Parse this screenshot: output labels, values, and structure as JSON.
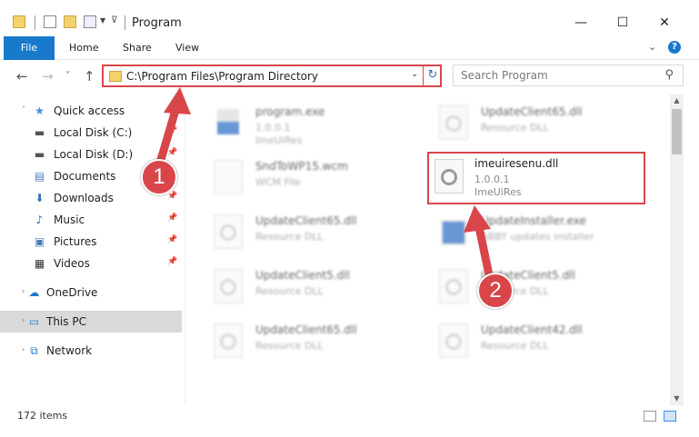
{
  "window": {
    "title": "Program",
    "minimize_glyph": "—",
    "maximize_glyph": "☐",
    "close_glyph": "✕"
  },
  "ribbon": {
    "tabs": [
      "File",
      "Home",
      "Share",
      "View"
    ],
    "help_glyph": "?"
  },
  "nav": {
    "back_glyph": "←",
    "forward_glyph": "→",
    "recent_glyph": "˅",
    "up_glyph": "↑"
  },
  "address": {
    "path": "C:\\Program Files\\Program Directory"
  },
  "search": {
    "placeholder": "Search Program"
  },
  "sidebar": {
    "items": [
      {
        "label": "Quick access",
        "icon": "star-icon"
      },
      {
        "label": "Local Disk (C:)",
        "icon": "drive-icon"
      },
      {
        "label": "Local Disk (D:)",
        "icon": "drive-icon"
      },
      {
        "label": "Documents",
        "icon": "documents-icon"
      },
      {
        "label": "Downloads",
        "icon": "download-icon"
      },
      {
        "label": "Music",
        "icon": "music-icon"
      },
      {
        "label": "Pictures",
        "icon": "pictures-icon"
      },
      {
        "label": "Videos",
        "icon": "videos-icon"
      },
      {
        "label": "OneDrive",
        "icon": "cloud-icon"
      },
      {
        "label": "This PC",
        "icon": "computer-icon"
      },
      {
        "label": "Network",
        "icon": "network-icon"
      }
    ]
  },
  "files": [
    {
      "name": "program.exe",
      "meta1": "1.0.0.1",
      "meta2": "ImeUiRes"
    },
    {
      "name": "UpdateClient65.dll",
      "meta1": "Resource DLL",
      "meta2": ""
    },
    {
      "name": "SndToWP15.wcm",
      "meta1": "WCM File",
      "meta2": ""
    },
    {
      "name": "imeuiresenu.dll",
      "meta1": "1.0.0.1",
      "meta2": "ImeUiRes"
    },
    {
      "name": "UpdateClient65.dll",
      "meta1": "Resource DLL",
      "meta2": ""
    },
    {
      "name": "UpdateInstaller.exe",
      "meta1": "ABBY updates installer",
      "meta2": ""
    },
    {
      "name": "UpdateClient5.dll",
      "meta1": "Resource DLL",
      "meta2": ""
    },
    {
      "name": "UpdateClient5.dll",
      "meta1": "Resource DLL",
      "meta2": ""
    },
    {
      "name": "UpdateClient65.dll",
      "meta1": "Resource DLL",
      "meta2": ""
    },
    {
      "name": "UpdateClient42.dll",
      "meta1": "Resource DLL",
      "meta2": ""
    }
  ],
  "status": {
    "item_count": "172 items"
  },
  "annotations": {
    "step1": "1",
    "step2": "2"
  },
  "colors": {
    "accent": "#1979ca",
    "highlight": "#d9464a"
  }
}
